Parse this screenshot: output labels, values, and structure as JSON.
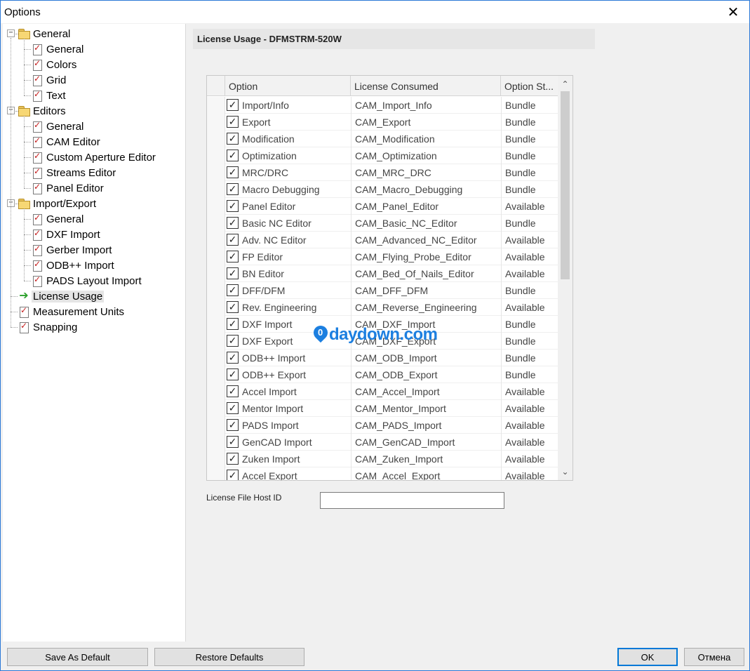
{
  "window": {
    "title": "Options"
  },
  "tree": {
    "nodes": [
      {
        "label": "General",
        "level": 0,
        "kind": "folder",
        "expanded": true
      },
      {
        "label": "General",
        "level": 1,
        "kind": "page"
      },
      {
        "label": "Colors",
        "level": 1,
        "kind": "page"
      },
      {
        "label": "Grid",
        "level": 1,
        "kind": "page"
      },
      {
        "label": "Text",
        "level": 1,
        "kind": "page"
      },
      {
        "label": "Editors",
        "level": 0,
        "kind": "folder",
        "expanded": true
      },
      {
        "label": "General",
        "level": 1,
        "kind": "page"
      },
      {
        "label": "CAM Editor",
        "level": 1,
        "kind": "page"
      },
      {
        "label": "Custom Aperture Editor",
        "level": 1,
        "kind": "page"
      },
      {
        "label": "Streams Editor",
        "level": 1,
        "kind": "page"
      },
      {
        "label": "Panel Editor",
        "level": 1,
        "kind": "page"
      },
      {
        "label": "Import/Export",
        "level": 0,
        "kind": "folder",
        "expanded": true
      },
      {
        "label": "General",
        "level": 1,
        "kind": "page"
      },
      {
        "label": "DXF Import",
        "level": 1,
        "kind": "page"
      },
      {
        "label": "Gerber Import",
        "level": 1,
        "kind": "page"
      },
      {
        "label": "ODB++ Import",
        "level": 1,
        "kind": "page"
      },
      {
        "label": "PADS Layout Import",
        "level": 1,
        "kind": "page"
      },
      {
        "label": "License Usage",
        "level": 0,
        "kind": "arrow",
        "selected": true
      },
      {
        "label": "Measurement Units",
        "level": 0,
        "kind": "page"
      },
      {
        "label": "Snapping",
        "level": 0,
        "kind": "page"
      }
    ]
  },
  "panel": {
    "header": "License Usage - DFMSTRM-520W",
    "columns": [
      "Option",
      "License Consumed",
      "Option St..."
    ],
    "rows": [
      {
        "option": "Import/Info",
        "license": "CAM_Import_Info",
        "status": "Bundle",
        "checked": true
      },
      {
        "option": "Export",
        "license": "CAM_Export",
        "status": "Bundle",
        "checked": true
      },
      {
        "option": "Modification",
        "license": "CAM_Modification",
        "status": "Bundle",
        "checked": true
      },
      {
        "option": "Optimization",
        "license": "CAM_Optimization",
        "status": "Bundle",
        "checked": true
      },
      {
        "option": "MRC/DRC",
        "license": "CAM_MRC_DRC",
        "status": "Bundle",
        "checked": true
      },
      {
        "option": "Macro Debugging",
        "license": "CAM_Macro_Debugging",
        "status": "Bundle",
        "checked": true
      },
      {
        "option": "Panel Editor",
        "license": "CAM_Panel_Editor",
        "status": "Available",
        "checked": true
      },
      {
        "option": "Basic NC Editor",
        "license": "CAM_Basic_NC_Editor",
        "status": "Bundle",
        "checked": true
      },
      {
        "option": "Adv. NC Editor",
        "license": "CAM_Advanced_NC_Editor",
        "status": "Available",
        "checked": true
      },
      {
        "option": "FP Editor",
        "license": "CAM_Flying_Probe_Editor",
        "status": "Available",
        "checked": true
      },
      {
        "option": "BN Editor",
        "license": "CAM_Bed_Of_Nails_Editor",
        "status": "Available",
        "checked": true
      },
      {
        "option": "DFF/DFM",
        "license": "CAM_DFF_DFM",
        "status": "Bundle",
        "checked": true
      },
      {
        "option": "Rev. Engineering",
        "license": "CAM_Reverse_Engineering",
        "status": "Available",
        "checked": true
      },
      {
        "option": "DXF Import",
        "license": "CAM_DXF_Import",
        "status": "Bundle",
        "checked": true
      },
      {
        "option": "DXF Export",
        "license": "CAM_DXF_Export",
        "status": "Bundle",
        "checked": true
      },
      {
        "option": "ODB++ Import",
        "license": "CAM_ODB_Import",
        "status": "Bundle",
        "checked": true
      },
      {
        "option": "ODB++ Export",
        "license": "CAM_ODB_Export",
        "status": "Bundle",
        "checked": true
      },
      {
        "option": "Accel Import",
        "license": "CAM_Accel_Import",
        "status": "Available",
        "checked": true
      },
      {
        "option": "Mentor Import",
        "license": "CAM_Mentor_Import",
        "status": "Available",
        "checked": true
      },
      {
        "option": "PADS Import",
        "license": "CAM_PADS_Import",
        "status": "Available",
        "checked": true
      },
      {
        "option": "GenCAD Import",
        "license": "CAM_GenCAD_Import",
        "status": "Available",
        "checked": true
      },
      {
        "option": "Zuken Import",
        "license": "CAM_Zuken_Import",
        "status": "Available",
        "checked": true
      },
      {
        "option": "Accel Export",
        "license": "CAM_Accel_Export",
        "status": "Available",
        "checked": true
      }
    ],
    "host_label": "License File Host ID",
    "host_value": ""
  },
  "watermark": {
    "text": "daydown.com"
  },
  "buttons": {
    "save_default": "Save As Default",
    "restore_defaults": "Restore Defaults",
    "ok": "OK",
    "cancel": "Отмена"
  },
  "icons": {
    "close": "close-icon",
    "folder": "folder-icon",
    "page": "page-check-icon",
    "arrow": "arrow-right-icon",
    "checkbox": "checkbox-checked-icon"
  },
  "colors": {
    "accent": "#0078d7",
    "watermark": "#1c7fe0",
    "tree_arrow": "#2aa02a"
  }
}
